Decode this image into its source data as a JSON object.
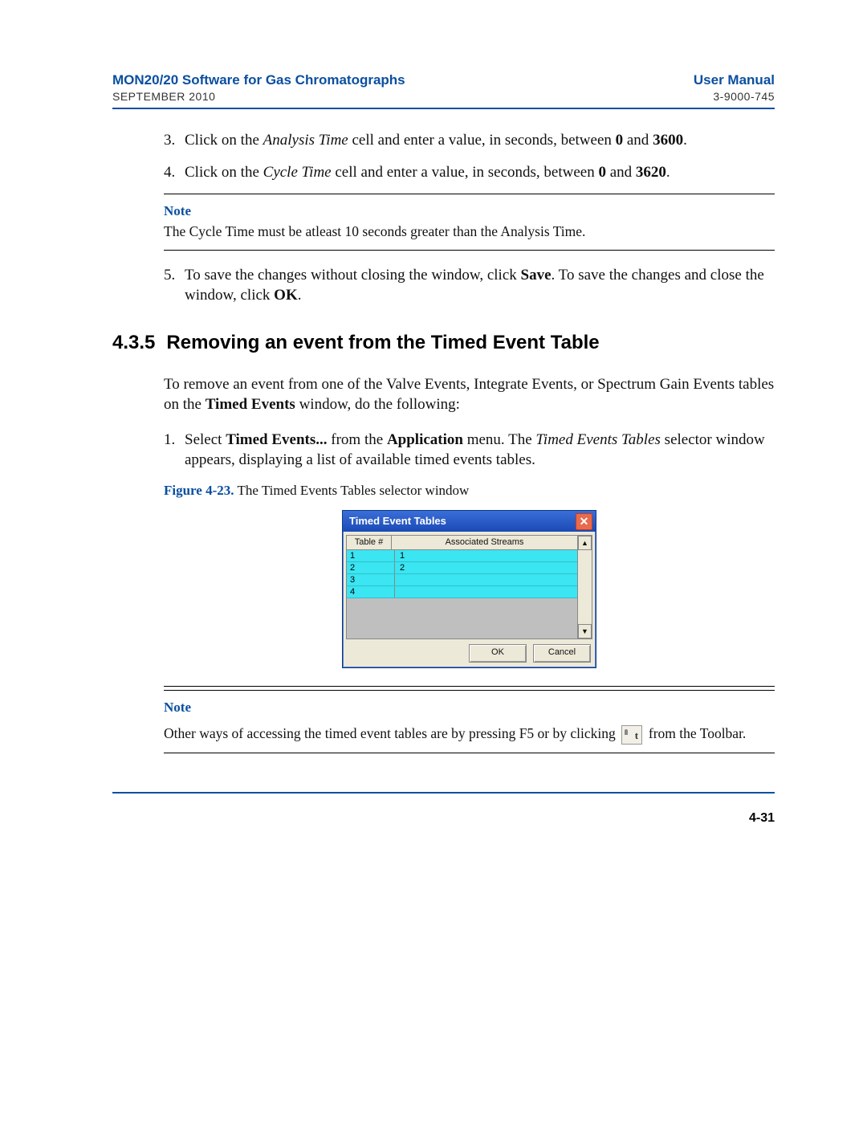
{
  "header": {
    "title_left": "MON20/20 Software for Gas Chromatographs",
    "title_right": "User Manual",
    "sub_left": "SEPTEMBER 2010",
    "sub_right": "3-9000-745"
  },
  "step3": {
    "num": "3.",
    "pre": "Click on the ",
    "italic": "Analysis Time",
    "mid": " cell and enter a value, in seconds, between ",
    "bold1": "0",
    "and": " and ",
    "bold2": "3600",
    "end": "."
  },
  "step4": {
    "num": "4.",
    "pre": "Click on the ",
    "italic": "Cycle Time",
    "mid": " cell and enter a value, in seconds, between ",
    "bold1": "0",
    "and": " and ",
    "bold2": "3620",
    "end": "."
  },
  "note1": {
    "label": "Note",
    "text": "The Cycle Time must be atleast 10 seconds greater than the Analysis Time."
  },
  "step5": {
    "num": "5.",
    "pre": "To save the changes without closing the window, click ",
    "bold1": "Save",
    "mid": ". To save the changes and close the window, click ",
    "bold2": "OK",
    "end": "."
  },
  "section": {
    "num": "4.3.5",
    "title": "Removing an event from the Timed Event Table"
  },
  "intro": {
    "pre": "To remove an event from one of the Valve Events, Integrate Events, or Spectrum Gain Events tables on the ",
    "bold": "Timed Events",
    "post": " window, do the following:"
  },
  "step1b": {
    "num": "1.",
    "pre": "Select ",
    "bold1": "Timed Events...",
    "mid1": " from the ",
    "bold2": "Application",
    "mid2": " menu.  The ",
    "italic": "Timed Events Tables",
    "post": " selector window appears, displaying a list of available timed events tables."
  },
  "fig": {
    "label": "Figure 4-23.",
    "caption": "  The Timed Events Tables selector window"
  },
  "dialog": {
    "title": "Timed Event Tables",
    "col1": "Table #",
    "col2": "Associated Streams",
    "rows": [
      {
        "n": "1",
        "s": "1"
      },
      {
        "n": "2",
        "s": "2"
      },
      {
        "n": "3",
        "s": ""
      },
      {
        "n": "4",
        "s": ""
      }
    ],
    "ok": "OK",
    "cancel": "Cancel"
  },
  "note2": {
    "label": "Note",
    "line1": "Other ways of accessing the timed event tables are by pressing F5 or by clicking ",
    "line2": " from the Toolbar."
  },
  "page_number": "4-31"
}
